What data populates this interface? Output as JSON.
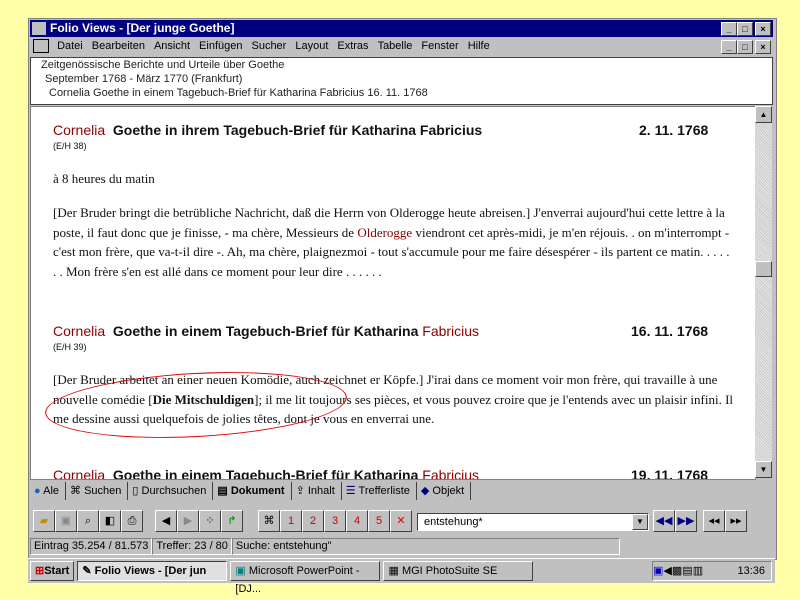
{
  "window": {
    "title": "Folio Views - [Der junge Goethe]"
  },
  "menu": [
    "Datei",
    "Bearbeiten",
    "Ansicht",
    "Einfügen",
    "Sucher",
    "Layout",
    "Extras",
    "Tabelle",
    "Fenster",
    "Hilfe"
  ],
  "breadcrumb": [
    "Zeitgenössische Berichte und Urteile über Goethe",
    "September 1768 - März 1770 (Frankfurt)",
    "Cornelia  Goethe in einem Tagebuch-Brief für Katharina Fabricius  16. 11. 1768"
  ],
  "entries": [
    {
      "name": "Cornelia",
      "title": "Goethe in ihrem Tagebuch-Brief für Katharina Fabricius",
      "title_red": "",
      "date": "2. 11. 1768",
      "ref": "(E/H 38)",
      "intro": "à 8 heures du matin",
      "p1": "[Der Bruder bringt die betrübliche Nachricht, daß die Herrn von Olderogge heute abreisen.] J'enverrai aujourd'hui cette lettre à la poste, il faut donc que je finisse, - ma chère, Messieurs de ",
      "p_red": "Olderogge",
      "p2": " viendront cet après-midi, je m'en réjouis. .   on m'interrompt - c'est mon frère, que va-t-il dire -. Ah, ma chère, plaignezmoi - tout s'accumule pour me faire désespérer - ils partent ce matin. . . . . . . Mon frère s'en est allé dans ce moment pour leur dire . . .    . . ."
    },
    {
      "name": "Cornelia",
      "title": "Goethe in einem Tagebuch-Brief für Katharina",
      "title_red": "Fabricius",
      "date": "16. 11. 1768",
      "ref": "(E/H 39)",
      "p1": "[Der Bruder arbeitet an einer neuen Komödie, auch zeichnet er Köpfe.] J'irai dans ce moment voir mon frère, qui travaille à une nouvelle comédie [",
      "bold": "Die Mitschuldigen",
      "p2": "]; il me lit toujours ses pièces, et vous pouvez croire que je l'entends avec un plaisir infini. Il me dessine aussi quelquefois de jolies têtes, dont je vous en enverrai une."
    },
    {
      "name": "Cornelia",
      "title": "Goethe in einem Tagebuch-Brief für Katharina",
      "title_red": "Fabricius",
      "date": "19. 11. 1768"
    }
  ],
  "tabs": [
    "Ale",
    "Suchen",
    "Durchsuchen",
    "Dokument",
    "Inhalt",
    "Trefferliste",
    "Objekt"
  ],
  "search": {
    "value": "entstehung*"
  },
  "status": {
    "entry": "Eintrag  35.254 / 81.573",
    "hits": "Treffer: 23 / 80",
    "query": "Suche: entstehung\""
  },
  "taskbar": {
    "start": "Start",
    "items": [
      "Folio Views - [Der jun",
      "Microsoft PowerPoint - [DJ...",
      "MGI PhotoSuite SE"
    ],
    "clock": "13:36"
  }
}
